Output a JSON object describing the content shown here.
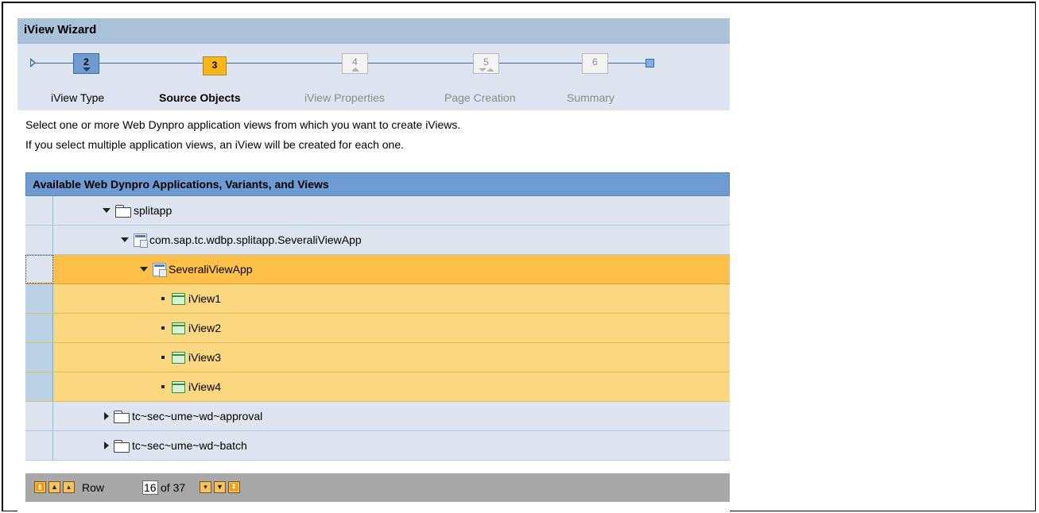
{
  "window": {
    "title": "iView Wizard"
  },
  "roadmap": {
    "steps": [
      {
        "number": "2",
        "label": "iView Type",
        "state": "done"
      },
      {
        "number": "3",
        "label": "Source Objects",
        "state": "current"
      },
      {
        "number": "4",
        "label": "iView Properties",
        "state": "future"
      },
      {
        "number": "5",
        "label": "Page Creation",
        "state": "future"
      },
      {
        "number": "6",
        "label": "Summary",
        "state": "future"
      }
    ]
  },
  "instructions": {
    "line1": "Select one or more Web Dynpro application views from which you want to create iViews.",
    "line2": "If you select multiple application views, an iView will be created for each one."
  },
  "table": {
    "title": "Available Web Dynpro Applications, Variants, and Views",
    "rows": [
      {
        "label": "splitapp",
        "icon": "folder-icon",
        "expander": "expanded",
        "level": 1
      },
      {
        "label": "com.sap.tc.wdbp.splitapp.SeveraliViewApp",
        "icon": "application-icon",
        "expander": "expanded",
        "level": 2
      },
      {
        "label": "SeveraliViewApp",
        "icon": "application-icon",
        "expander": "expanded",
        "level": 3,
        "selected": true,
        "lead": true
      },
      {
        "label": "iView1",
        "icon": "view-icon",
        "expander": "leaf",
        "level": 4,
        "selected": true
      },
      {
        "label": "iView2",
        "icon": "view-icon",
        "expander": "leaf",
        "level": 4,
        "selected": true
      },
      {
        "label": "iView3",
        "icon": "view-icon",
        "expander": "leaf",
        "level": 4,
        "selected": true
      },
      {
        "label": "iView4",
        "icon": "view-icon",
        "expander": "leaf",
        "level": 4,
        "selected": true
      },
      {
        "label": "tc~sec~ume~wd~approval",
        "icon": "folder-icon",
        "expander": "collapsed",
        "level": 1
      },
      {
        "label": "tc~sec~ume~wd~batch",
        "icon": "folder-icon",
        "expander": "collapsed",
        "level": 1
      }
    ]
  },
  "pager": {
    "row_label": "Row",
    "current_row": "16",
    "of_label": "of 37"
  },
  "colors": {
    "title_bar": "#a9c1d9",
    "table_header": "#6e9cd2",
    "selected_row": "#fbd77f",
    "lead_row": "#ffc04a",
    "current_step": "#f6b71b"
  }
}
